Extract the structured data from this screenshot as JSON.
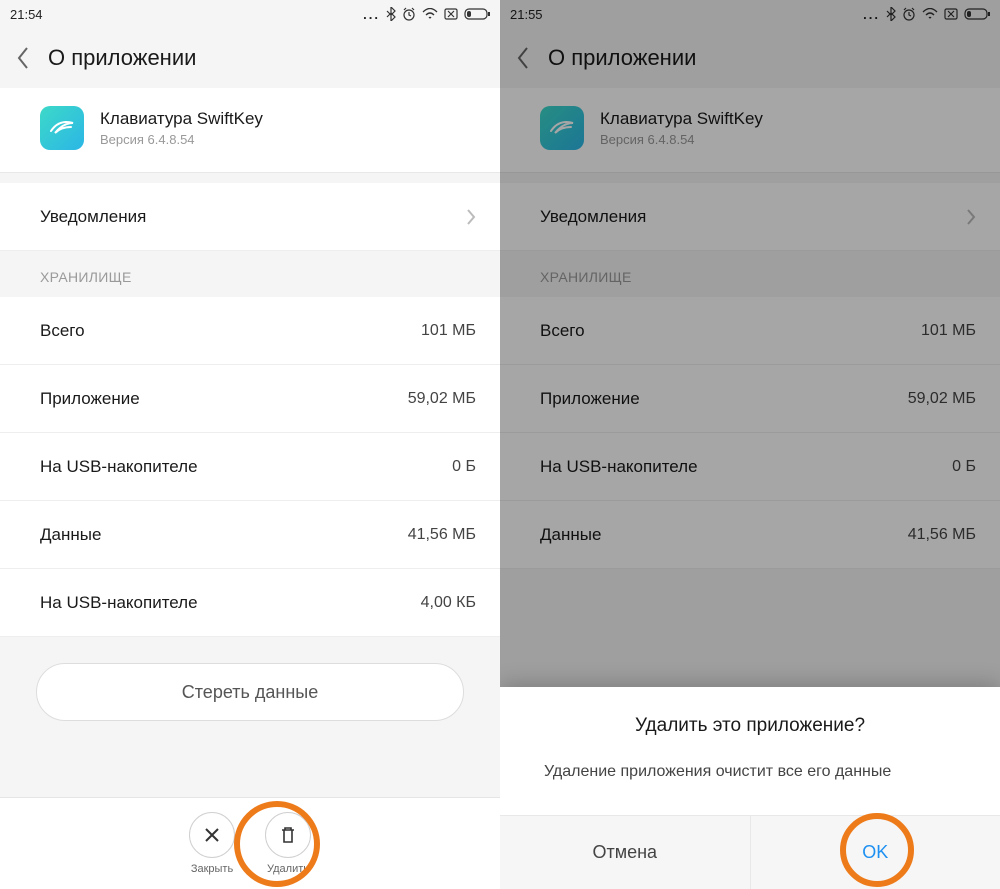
{
  "left": {
    "time": "21:54",
    "title": "О приложении",
    "app": {
      "name": "Клавиатура SwiftKey",
      "version": "Версия 6.4.8.54"
    },
    "rows": {
      "notifications": "Уведомления",
      "section": "ХРАНИЛИЩЕ",
      "total_l": "Всего",
      "total_v": "101 МБ",
      "app_l": "Приложение",
      "app_v": "59,02 МБ",
      "usb1_l": "На USB-накопителе",
      "usb1_v": "0 Б",
      "data_l": "Данные",
      "data_v": "41,56 МБ",
      "usb2_l": "На USB-накопителе",
      "usb2_v": "4,00 КБ"
    },
    "clear_btn": "Стереть данные",
    "actions": {
      "close": "Закрыть",
      "delete": "Удалить"
    }
  },
  "right": {
    "time": "21:55",
    "title": "О приложении",
    "app": {
      "name": "Клавиатура SwiftKey",
      "version": "Версия 6.4.8.54"
    },
    "rows": {
      "notifications": "Уведомления",
      "section": "ХРАНИЛИЩЕ",
      "total_l": "Всего",
      "total_v": "101 МБ",
      "app_l": "Приложение",
      "app_v": "59,02 МБ",
      "usb1_l": "На USB-накопителе",
      "usb1_v": "0 Б",
      "data_l": "Данные",
      "data_v": "41,56 МБ"
    },
    "dialog": {
      "title": "Удалить это приложение?",
      "message": "Удаление приложения очистит все его данные",
      "cancel": "Отмена",
      "ok": "OK"
    }
  },
  "status_dots": "..."
}
